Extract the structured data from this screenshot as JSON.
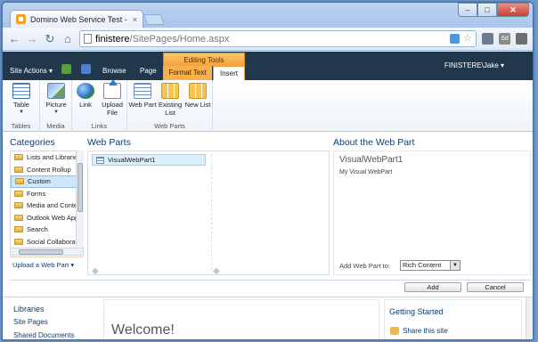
{
  "browser": {
    "tab_title": "Domino Web Service Test -",
    "tab_close": "×",
    "window_buttons": {
      "minimize": "–",
      "maximize": "□",
      "close": "✕"
    },
    "url_host": "finistere",
    "url_path": "/SitePages/Home.aspx",
    "nav": {
      "back": "←",
      "forward": "→",
      "reload": "↻",
      "home": "⌂"
    },
    "star": "☆",
    "toolbar_badge": "Sd"
  },
  "sharepoint": {
    "site_actions": "Site Actions ▾",
    "tabs": {
      "browse": "Browse",
      "page": "Page",
      "format_text": "Format Text",
      "insert": "Insert"
    },
    "contextual_group": "Editing Tools",
    "user": "FINISTERE\\Jake ▾",
    "ribbon": {
      "groups": {
        "tables": "Tables",
        "media": "Media",
        "links": "Links",
        "web_parts": "Web Parts"
      },
      "buttons": {
        "table": "Table",
        "picture": "Picture",
        "link": "Link",
        "upload_file": "Upload File",
        "web_part": "Web Part",
        "existing_list": "Existing List",
        "new_list": "New List"
      }
    },
    "categories_title": "Categories",
    "categories": [
      "Lists and Libraries",
      "Content Rollup",
      "Custom",
      "Forms",
      "Media and Content",
      "Outlook Web App",
      "Search",
      "Social Collaboration"
    ],
    "selected_category": "Custom",
    "upload_web_part": "Upload a Web Part ▾",
    "web_parts_title": "Web Parts",
    "web_parts": [
      "VisualWebPart1"
    ],
    "about_title": "About the Web Part",
    "about_name": "VisualWebPart1",
    "about_desc": "My Visual WebPart",
    "add_to_label": "Add Web Part to:",
    "add_to_value": "Rich Content",
    "add_button": "Add",
    "cancel_button": "Cancel",
    "quicklaunch": {
      "heading": "Libraries",
      "links": [
        "Site Pages",
        "Shared Documents"
      ]
    },
    "welcome": "Welcome!",
    "getting_started": {
      "heading": "Getting Started",
      "link": "Share this site"
    }
  },
  "colors": {
    "suite_bar": "#21374c",
    "contextual_tab": "#f7b04c",
    "link": "#0c3c72"
  }
}
